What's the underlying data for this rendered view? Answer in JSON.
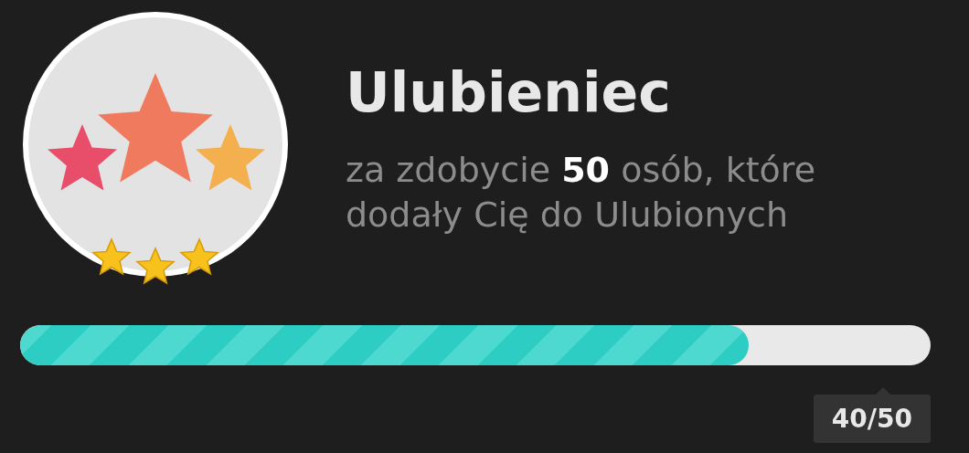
{
  "badge": {
    "stars": 3
  },
  "title": "Ulubieniec",
  "description": "za zdobycie **50** osób, które dodały Cię do Ulubionych",
  "progress": {
    "level": 0.8,
    "reading": "40/50"
  }
}
